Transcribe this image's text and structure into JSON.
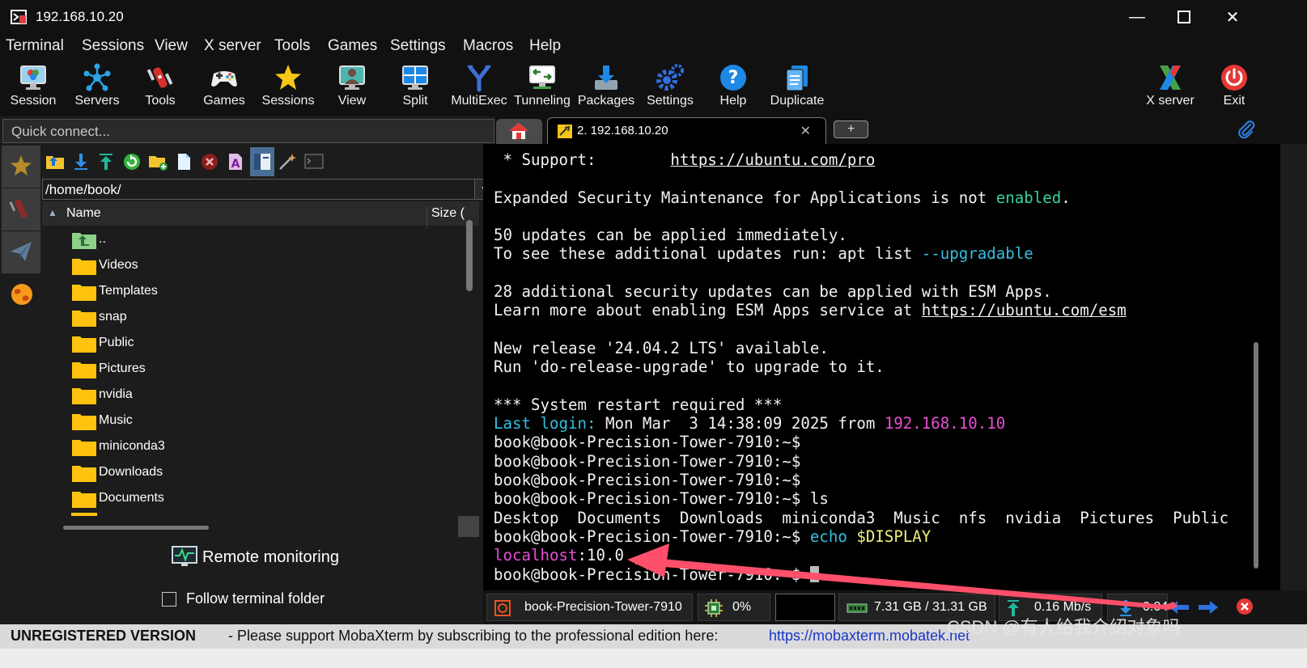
{
  "window": {
    "title": "192.168.10.20"
  },
  "menu": [
    "Terminal",
    "Sessions",
    "View",
    "X server",
    "Tools",
    "Games",
    "Settings",
    "Macros",
    "Help"
  ],
  "toolbar": {
    "session": "Session",
    "servers": "Servers",
    "tools": "Tools",
    "games": "Games",
    "sessions": "Sessions",
    "view": "View",
    "split": "Split",
    "multiexec": "MultiExec",
    "tunneling": "Tunneling",
    "packages": "Packages",
    "settings": "Settings",
    "help": "Help",
    "duplicate": "Duplicate",
    "xserver": "X server",
    "exit": "Exit"
  },
  "quick_connect": {
    "placeholder": "Quick connect..."
  },
  "browser": {
    "path": "/home/book/",
    "col_name": "Name",
    "col_size": "Size (",
    "files": [
      "..",
      "Videos",
      "Templates",
      "snap",
      "Public",
      "Pictures",
      "nvidia",
      "Music",
      "miniconda3",
      "Downloads",
      "Documents"
    ],
    "remote_monitoring": "Remote monitoring",
    "follow_folder": "Follow terminal folder"
  },
  "tabs": {
    "session_label": "2. 192.168.10.20",
    "new_tab": "+"
  },
  "terminal": {
    "l1a": " * Support:        ",
    "l1b": "https://ubuntu.com/pro",
    "l2a": "Expanded Security Maintenance for Applications is not ",
    "l2b": "enabled",
    "l2c": ".",
    "l3": "50 updates can be applied immediately.",
    "l4a": "To see these additional updates run: apt list ",
    "l4b": "--upgradable",
    "l5": "28 additional security updates can be applied with ESM Apps.",
    "l6a": "Learn more about enabling ESM Apps service at ",
    "l6b": "https://ubuntu.com/esm",
    "l7": "New release '24.04.2 LTS' available.",
    "l8": "Run 'do-release-upgrade' to upgrade to it.",
    "l9": "*** System restart required ***",
    "l10a": "Last login:",
    "l10b": " Mon Mar  3 14:38:09 2025 from ",
    "l10c": "192.168.10.10",
    "prompt": "book@book-Precision-Tower-7910:~$",
    "cmd_ls": " ls",
    "ls_out": "Desktop  Documents  Downloads  miniconda3  Music  nfs  nvidia  Pictures  Public",
    "cmd_echo_a": " echo",
    "cmd_echo_b": " $DISPLAY",
    "disp_a": "localhost",
    "disp_b": ":10.0"
  },
  "status": {
    "host": "book-Precision-Tower-7910",
    "cpu": "0%",
    "mem": "7.31 GB / 31.31 GB",
    "up": "0.16 Mb/s",
    "down": "0.04"
  },
  "unregistered": {
    "bold": "UNREGISTERED VERSION",
    "msg": " -  Please support MobaXterm by subscribing to the professional edition here:",
    "link": "https://mobaxterm.mobatek.net"
  },
  "watermark": "CSDN @有人给我介绍对象吗",
  "colors": {
    "accent_green": "#35d49a",
    "accent_cyan": "#35bfe0",
    "accent_magenta": "#e84fd6",
    "accent_yellow": "#f0f07a",
    "annotation_arrow": "#ff4f6a"
  }
}
